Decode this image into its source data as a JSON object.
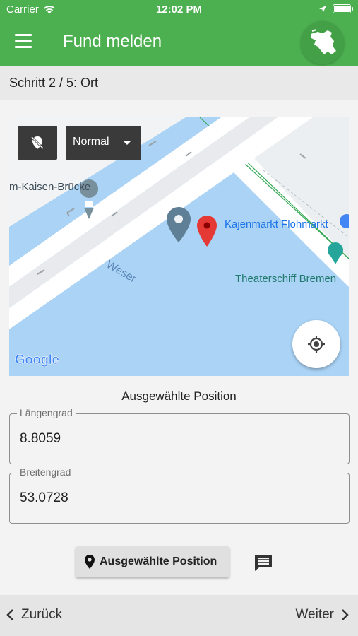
{
  "status_bar": {
    "carrier": "Carrier",
    "time": "12:02 PM"
  },
  "app_bar": {
    "title": "Fund melden"
  },
  "step": {
    "text": "Schritt 2 / 5: Ort"
  },
  "map": {
    "type_selector": "Normal",
    "labels": {
      "bridge": "m-Kaisen-Brücke",
      "river": "Weser",
      "poi_1": "Kajenmarkt Flohmarkt",
      "poi_2": "Theaterschiff Bremen"
    },
    "attribution": "Google"
  },
  "form": {
    "heading": "Ausgewählte Position",
    "longitude": {
      "label": "Längengrad",
      "value": "8.8059"
    },
    "latitude": {
      "label": "Breitengrad",
      "value": "53.0728"
    },
    "selected_position_button": "Ausgewählte Position"
  },
  "nav": {
    "back": "Zurück",
    "next": "Weiter"
  },
  "colors": {
    "primary": "#4caf50",
    "water": "#aad3f5",
    "pin_red": "#e53935",
    "pin_gray": "#5f7f96"
  }
}
